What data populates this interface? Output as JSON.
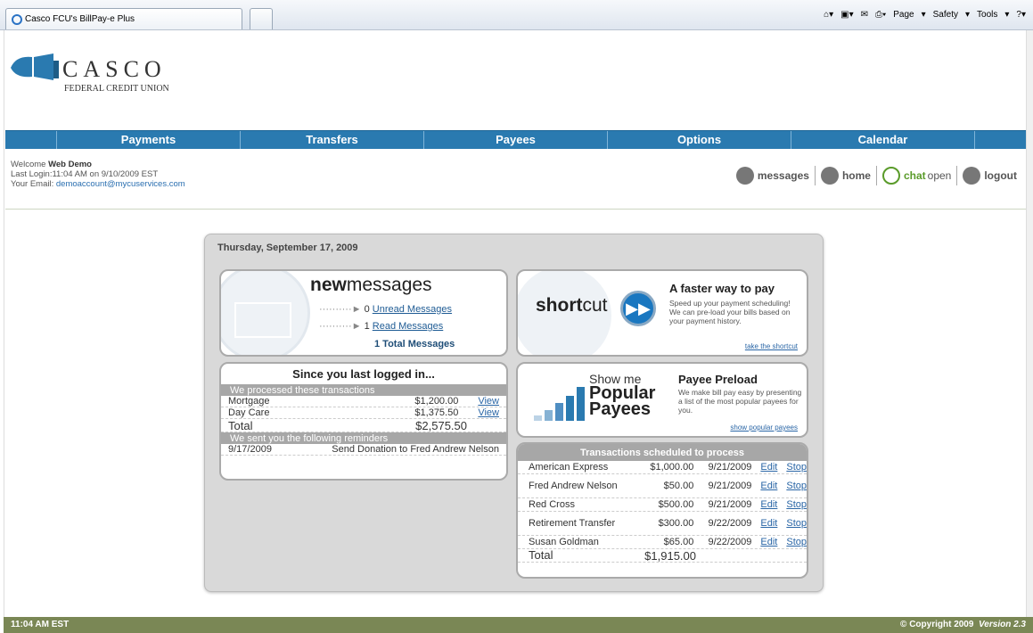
{
  "browser": {
    "tab_title": "Casco FCU's BillPay-e Plus",
    "tools": [
      "Page",
      "Safety",
      "Tools"
    ]
  },
  "logo": {
    "name": "CASCO",
    "sub": "FEDERAL CREDIT UNION"
  },
  "nav": [
    "Payments",
    "Transfers",
    "Payees",
    "Options",
    "Calendar"
  ],
  "welcome": {
    "prefix": "Welcome",
    "user": "Web Demo",
    "last_login": "Last Login:11:04 AM on 9/10/2009 EST",
    "email_label": "Your Email:",
    "email": "demoaccount@mycuservices.com"
  },
  "quick": {
    "messages": "messages",
    "home": "home",
    "chat": "chat",
    "chat_status": "open",
    "logout": "logout"
  },
  "date": "Thursday, September 17, 2009",
  "messages": {
    "title_bold": "new",
    "title": "messages",
    "unread_count": "0",
    "unread": "Unread Messages",
    "read_count": "1",
    "read": "Read Messages",
    "total": "1 Total Messages"
  },
  "since": {
    "title": "Since you last logged in...",
    "processed_header": "We processed these transactions",
    "transactions": [
      {
        "name": "Mortgage",
        "amount": "$1,200.00",
        "action": "View"
      },
      {
        "name": "Day Care",
        "amount": "$1,375.50",
        "action": "View"
      }
    ],
    "total_label": "Total",
    "total": "$2,575.50",
    "reminders_header": "We sent you the following reminders",
    "reminders": [
      {
        "date": "9/17/2009",
        "text": "Send Donation to Fred Andrew Nelson"
      }
    ]
  },
  "shortcut": {
    "word_bold": "short",
    "word": "cut",
    "title": "A faster way to pay",
    "text": "Speed up your payment scheduling! We can pre-load your bills based on your payment history.",
    "link": "take the shortcut"
  },
  "preload": {
    "show": "Show me",
    "line1": "Popular",
    "line2": "Payees",
    "title": "Payee Preload",
    "text": "We make bill pay easy by presenting a list of the most popular payees for you.",
    "link": "show popular payees"
  },
  "scheduled": {
    "header": "Transactions scheduled to process",
    "rows": [
      {
        "payee": "American Express",
        "amount": "$1,000.00",
        "date": "9/21/2009",
        "edit": "Edit",
        "stop": "Stop"
      },
      {
        "payee": "Fred Andrew Nelson",
        "amount": "$50.00",
        "date": "9/21/2009",
        "edit": "Edit",
        "stop": "Stop"
      },
      {
        "payee": "Red Cross",
        "amount": "$500.00",
        "date": "9/21/2009",
        "edit": "Edit",
        "stop": "Stop"
      },
      {
        "payee": "Retirement Transfer",
        "amount": "$300.00",
        "date": "9/22/2009",
        "edit": "Edit",
        "stop": "Stop"
      },
      {
        "payee": "Susan Goldman",
        "amount": "$65.00",
        "date": "9/22/2009",
        "edit": "Edit",
        "stop": "Stop"
      }
    ],
    "total_label": "Total",
    "total": "$1,915.00"
  },
  "footer": {
    "time": "11:04 AM EST",
    "copyright": "© Copyright 2009",
    "version": "Version 2.3"
  }
}
